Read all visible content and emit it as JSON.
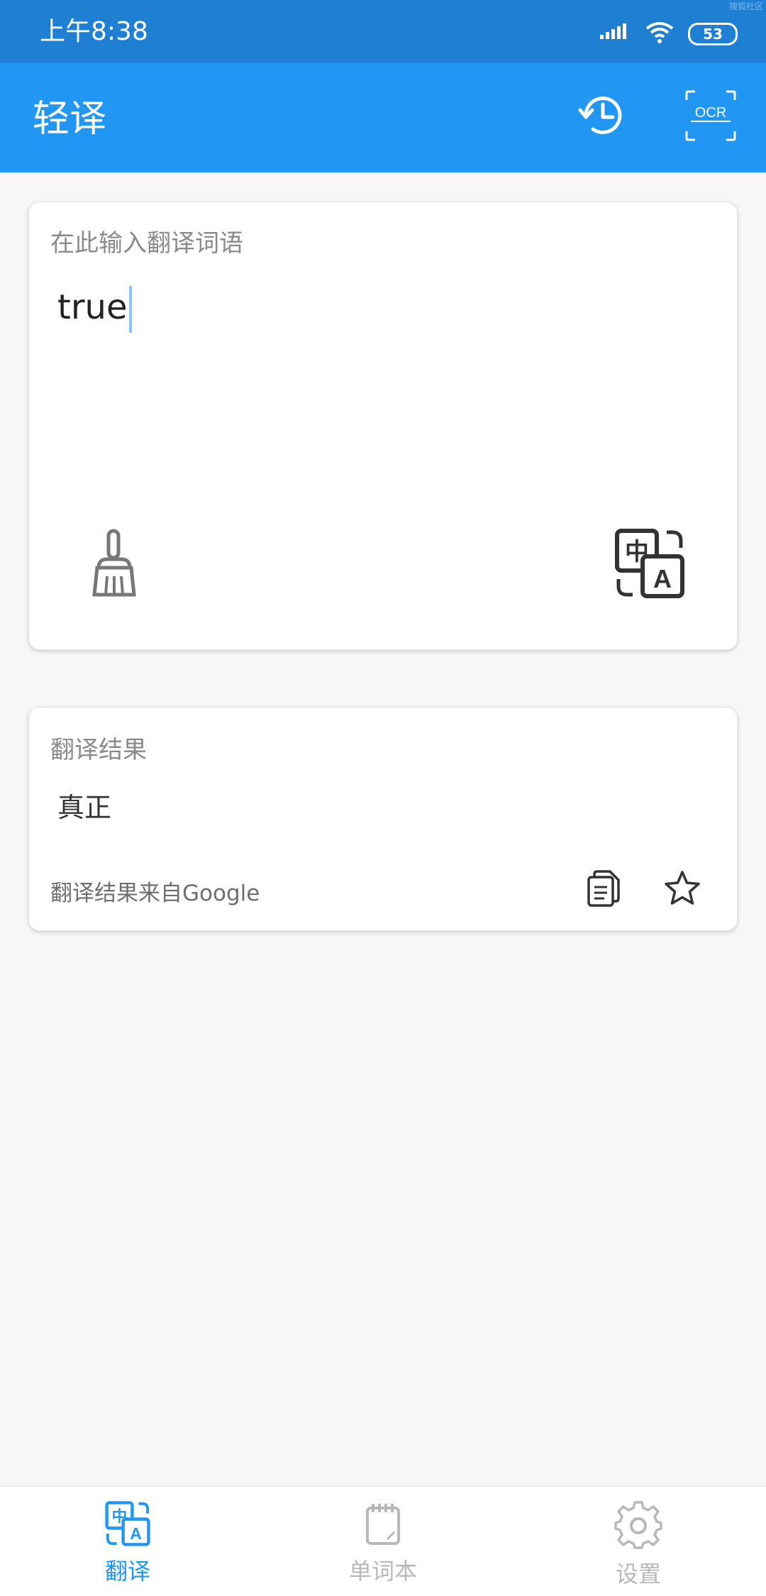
{
  "status": {
    "time": "上午8:38",
    "battery": "53",
    "watermark": "搜狐社区"
  },
  "appbar": {
    "title": "轻译"
  },
  "input_card": {
    "placeholder": "在此输入翻译词语",
    "value": "true"
  },
  "result_card": {
    "label": "翻译结果",
    "result": "真正",
    "source": "翻译结果来自Google"
  },
  "nav": {
    "items": [
      {
        "label": "翻译",
        "active": true
      },
      {
        "label": "单词本",
        "active": false
      },
      {
        "label": "设置",
        "active": false
      }
    ]
  },
  "colors": {
    "status_bar": "#1f7fd3",
    "app_bar": "#2196f3",
    "active_nav": "#2196f3",
    "inactive_nav": "#b8b8b8"
  },
  "icons": {
    "history": "history-icon",
    "ocr": "ocr-scan-icon",
    "clear": "broom-icon",
    "translate": "translate-icon",
    "copy": "copy-icon",
    "favorite": "star-icon",
    "notebook": "notebook-icon",
    "settings": "gear-icon"
  }
}
